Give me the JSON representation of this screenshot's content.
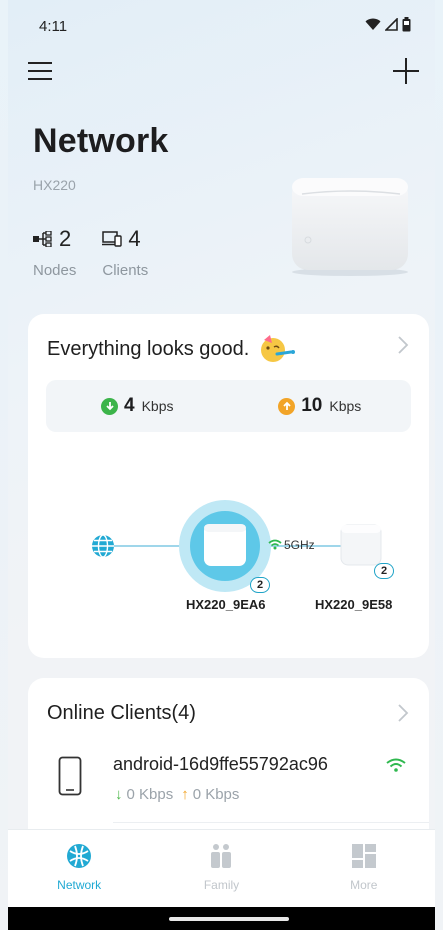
{
  "status_bar": {
    "time": "4:11"
  },
  "header": {
    "title": "Network",
    "model": "HX220",
    "nodes_count": "2",
    "nodes_label": "Nodes",
    "clients_count": "4",
    "clients_label": "Clients"
  },
  "status_card": {
    "title": "Everything looks good.",
    "download_value": "4",
    "download_unit": "Kbps",
    "upload_value": "10",
    "upload_unit": "Kbps",
    "main_node": {
      "name": "HX220_9EA6",
      "badge": "2"
    },
    "satellite_node": {
      "name": "HX220_9E58",
      "badge": "2"
    },
    "link_band": "5GHz"
  },
  "clients_card": {
    "title": "Online Clients(4)",
    "clients": [
      {
        "name": "android-16d9ffe55792ac96",
        "down": "0 Kbps",
        "up": "0 Kbps"
      }
    ]
  },
  "bottom_nav": [
    {
      "label": "Network",
      "active": true
    },
    {
      "label": "Family",
      "active": false
    },
    {
      "label": "More",
      "active": false
    }
  ],
  "colors": {
    "accent": "#21a9d3",
    "download": "#3cb44a",
    "upload": "#f2a428",
    "wifi": "#2fb84f"
  }
}
